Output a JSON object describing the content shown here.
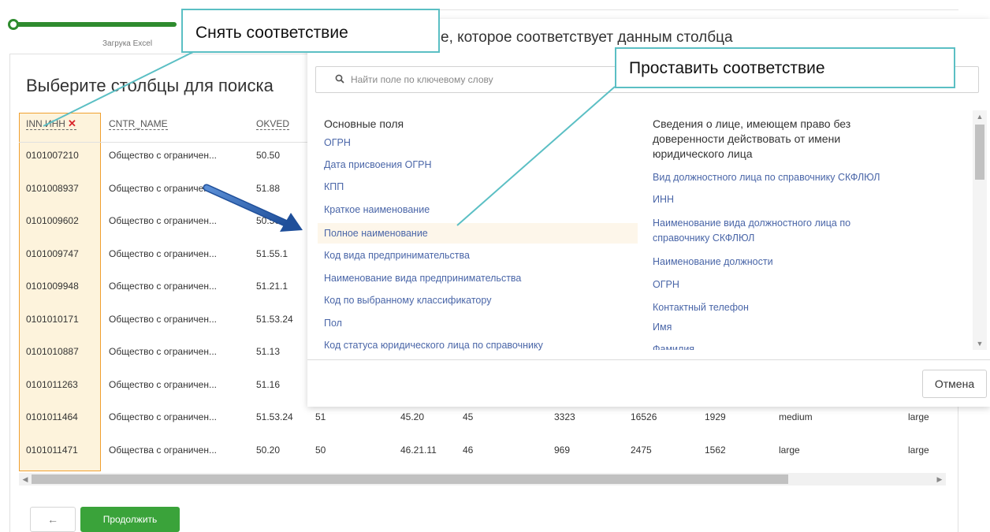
{
  "wizard": {
    "step_label": "Загрука Excel",
    "back_label": "←",
    "continue_label": "Продолжить"
  },
  "page": {
    "title": "Выберите столбцы для поиска"
  },
  "table": {
    "inn_header": "INN ИНН",
    "remove_mark": "✕",
    "cntr_header": "CNTR_NAME",
    "okved_header": "OKVED",
    "rows": [
      [
        "0101007210",
        "Общество с ограничен...",
        "50.50"
      ],
      [
        "0101008937",
        "Общество с ограничен...",
        "51.88"
      ],
      [
        "0101009602",
        "Общество с ограничен...",
        "50.50"
      ],
      [
        "0101009747",
        "Общество с ограничен...",
        "51.55.1"
      ],
      [
        "0101009948",
        "Общество с ограничен...",
        "51.21.1"
      ],
      [
        "0101010171",
        "Общество с ограничен...",
        "51.53.24"
      ],
      [
        "0101010887",
        "Общество с ограничен...",
        "51.13"
      ],
      [
        "0101011263",
        "Общество с ограничен...",
        "51.16"
      ],
      [
        "0101011464",
        "Общество с ограничен...",
        "51.53.24",
        "51",
        "45.20",
        "45",
        "3323",
        "16526",
        "1929",
        "medium",
        "large"
      ],
      [
        "0101011471",
        "Общества с ограничен...",
        "50.20",
        "50",
        "46.21.11",
        "46",
        "969",
        "2475",
        "1562",
        "large",
        "large"
      ]
    ]
  },
  "modal": {
    "title_fragment": "е, которое соответствует данным столбца",
    "search_placeholder": "Найти поле по ключевому слову",
    "left_group": {
      "title": "Основные поля",
      "fields": [
        "ОГРН",
        "Дата присвоения ОГРН",
        "КПП",
        "Краткое наименование",
        "Полное наименование",
        "Код вида предпринимательства",
        "Наименование вида предпринимательства",
        "Код по выбранному классификатору",
        "Пол",
        "Код статуса юридического лица по справочнику"
      ]
    },
    "right_group": {
      "title_lines": [
        "Сведения о лице, имеющем право без",
        "доверенности действовать от имени",
        "юридического лица"
      ],
      "fields": [
        "Вид должностного лица по справочнику СКФЛЮЛ",
        "ИНН",
        "Наименование вида должностного лица по",
        "справочнику СКФЛЮЛ",
        "Наименование должности",
        "ОГРН",
        "Контактный телефон",
        "Имя",
        "Фамилия"
      ]
    },
    "cancel_label": "Отмена"
  },
  "callouts": {
    "remove": "Снять соответствие",
    "assign": "Проставить соответствие"
  },
  "colors": {
    "accent_green": "#3aa33a",
    "highlight": "#f0a030",
    "link": "#4a66a8",
    "callout_border": "#5bbfc4"
  }
}
